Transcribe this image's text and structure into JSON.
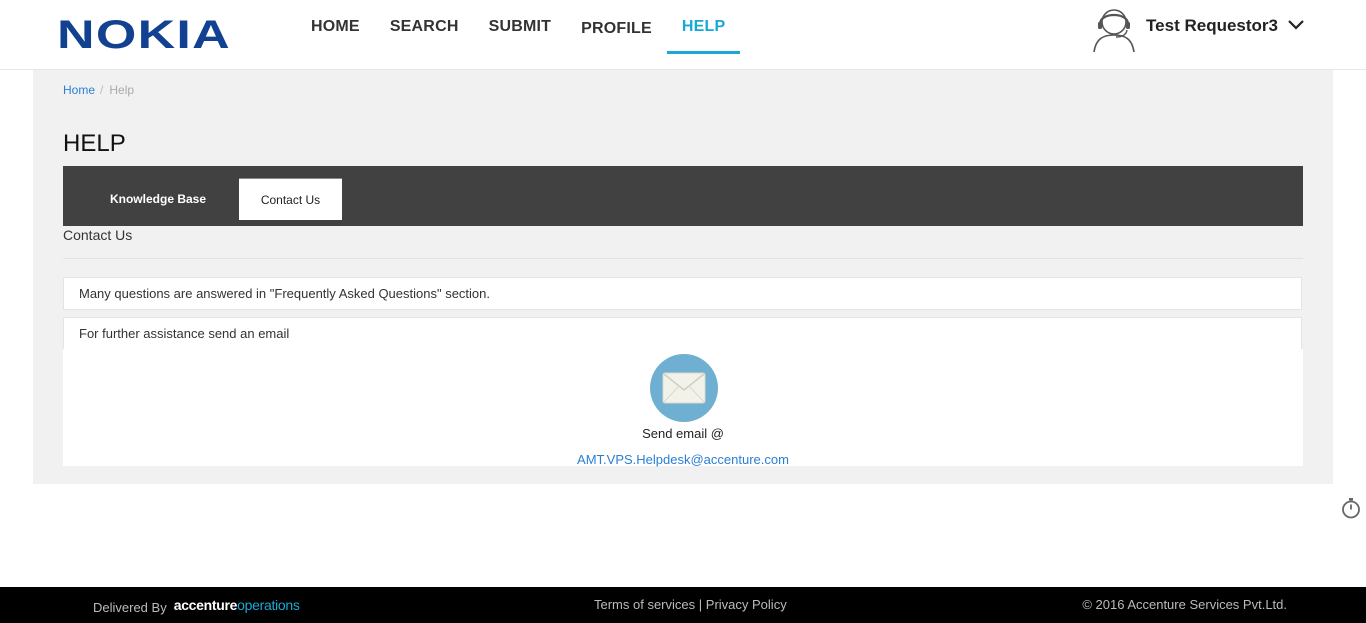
{
  "header": {
    "logo_text": "NOKIA",
    "nav": [
      {
        "label": "HOME"
      },
      {
        "label": "SEARCH"
      },
      {
        "label": "SUBMIT"
      },
      {
        "label": "PROFILE"
      },
      {
        "label": "HELP",
        "active": true
      }
    ],
    "user_name": "Test Requestor3",
    "accent_color": "#1aa8d6",
    "logo_color": "#124191"
  },
  "breadcrumb": {
    "home": "Home",
    "separator": "/",
    "current": "Help"
  },
  "page": {
    "title": "HELP",
    "tabs": [
      {
        "label": "Knowledge Base",
        "active": false
      },
      {
        "label": "Contact Us",
        "active": true
      }
    ],
    "section_label": "Contact Us",
    "info_rows": [
      "Many questions are answered in \"Frequently Asked Questions\" section.",
      "For further assistance send an email"
    ],
    "email": {
      "icon": "envelope-icon",
      "label": "Send email @",
      "address": "AMT.VPS.Helpdesk@accenture.com"
    }
  },
  "footer": {
    "delivered_by": "Delivered By",
    "brand_part1": "accenture",
    "brand_part2": "operations",
    "terms": "Terms of services",
    "divider": "|",
    "privacy": "Privacy Policy",
    "copyright": "© 2016 Accenture Services Pvt.Ltd."
  },
  "icons": {
    "user": "user-avatar-icon",
    "dropdown": "chevron-down-icon",
    "timer": "stopwatch-icon"
  }
}
